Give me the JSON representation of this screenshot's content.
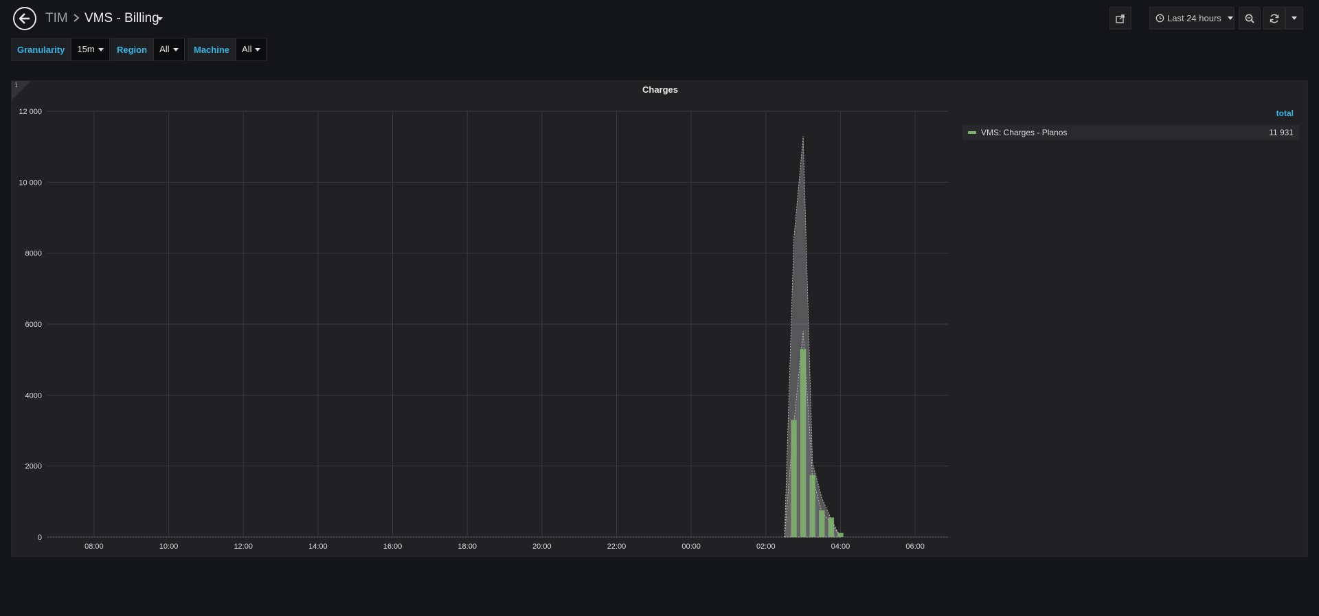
{
  "breadcrumb": {
    "folder": "TIM",
    "title": "VMS - Billing"
  },
  "toolbar": {
    "time_range": "Last 24 hours"
  },
  "variables": [
    {
      "label": "Granularity",
      "value": "15m"
    },
    {
      "label": "Region",
      "value": "All"
    },
    {
      "label": "Machine",
      "value": "All"
    }
  ],
  "panel": {
    "info": "i",
    "title": "Charges",
    "legend": {
      "column": "total",
      "items": [
        {
          "name": "VMS: Charges - Planos",
          "total": "11 931",
          "color": "#7eb26d"
        }
      ]
    }
  },
  "colors": {
    "accent": "#33b5e5",
    "series": "#7eb26d",
    "background": "#141518",
    "panel": "#212124"
  },
  "chart_data": {
    "type": "bar",
    "title": "Charges",
    "x_ticks": [
      "08:00",
      "10:00",
      "12:00",
      "14:00",
      "16:00",
      "18:00",
      "20:00",
      "22:00",
      "00:00",
      "02:00",
      "04:00",
      "06:00"
    ],
    "x_range_hours": [
      6.75,
      30.9
    ],
    "y_ticks": [
      "0",
      "2000",
      "4000",
      "6000",
      "8000",
      "10 000",
      "12 000"
    ],
    "ylim": [
      0,
      12000
    ],
    "grid": true,
    "legend_position": "right",
    "series": [
      {
        "name": "VMS: Charges - Planos",
        "time": [
          "02:45",
          "03:00",
          "03:15",
          "03:30",
          "03:45",
          "04:00"
        ],
        "values": [
          3300,
          5300,
          1750,
          750,
          550,
          120
        ]
      }
    ],
    "overlays": [
      {
        "type": "area",
        "points": [
          [
            26.5,
            0
          ],
          [
            26.75,
            8400
          ],
          [
            27.0,
            11300
          ],
          [
            27.25,
            2100
          ],
          [
            27.5,
            1100
          ],
          [
            27.75,
            500
          ],
          [
            28.0,
            0
          ]
        ]
      },
      {
        "type": "area",
        "points": [
          [
            26.5,
            0
          ],
          [
            26.75,
            3200
          ],
          [
            27.0,
            5800
          ],
          [
            27.25,
            1700
          ],
          [
            27.5,
            700
          ],
          [
            27.75,
            400
          ],
          [
            28.0,
            0
          ]
        ]
      }
    ]
  }
}
